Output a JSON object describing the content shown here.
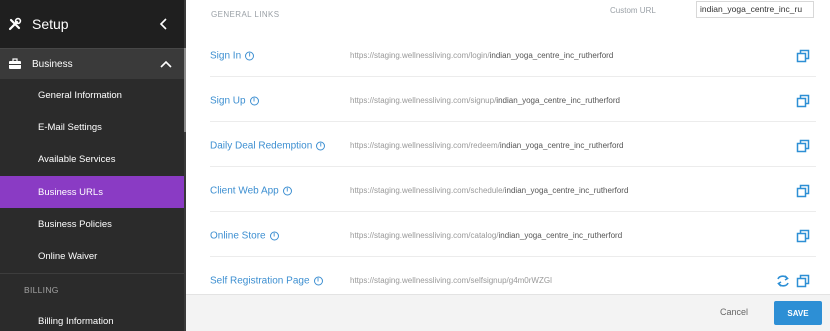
{
  "sidebar": {
    "title": "Setup",
    "section": "Business",
    "items": [
      {
        "label": "General Information",
        "active": false
      },
      {
        "label": "E-Mail Settings",
        "active": false
      },
      {
        "label": "Available Services",
        "active": false
      },
      {
        "label": "Business URLs",
        "active": true
      },
      {
        "label": "Business Policies",
        "active": false
      },
      {
        "label": "Online Waiver",
        "active": false
      }
    ],
    "divider": "BILLING",
    "billing_items": [
      {
        "label": "Billing Information"
      }
    ]
  },
  "main": {
    "section_title": "GENERAL LINKS",
    "custom_url_label": "Custom URL",
    "custom_url_value": "indian_yoga_centre_inc_ru",
    "links": [
      {
        "name": "Sign In",
        "base": "https://staging.wellnessliving.com/login/",
        "slug": "indian_yoga_centre_inc_rutherford",
        "refresh": false
      },
      {
        "name": "Sign Up",
        "base": "https://staging.wellnessliving.com/signup/",
        "slug": "indian_yoga_centre_inc_rutherford",
        "refresh": false
      },
      {
        "name": "Daily Deal Redemption",
        "base": "https://staging.wellnessliving.com/redeem/",
        "slug": "indian_yoga_centre_inc_rutherford",
        "refresh": false
      },
      {
        "name": "Client Web App",
        "base": "https://staging.wellnessliving.com/schedule/",
        "slug": "indian_yoga_centre_inc_rutherford",
        "refresh": false
      },
      {
        "name": "Online Store",
        "base": "https://staging.wellnessliving.com/catalog/",
        "slug": "indian_yoga_centre_inc_rutherford",
        "refresh": false
      },
      {
        "name": "Self Registration Page",
        "base": "https://staging.wellnessliving.com/selfsignup/g4m0rWZGl",
        "slug": "",
        "refresh": true
      }
    ]
  },
  "footer": {
    "cancel_label": "Cancel",
    "save_label": "SAVE"
  },
  "colors": {
    "accent": "#8a3bc4",
    "link": "#3d8fd1",
    "save": "#2d8fd5",
    "sidebar_bg": "#2b2b2b"
  },
  "icons": {
    "logo": "wrench-screwdriver-icon",
    "collapse": "chevron-left-icon",
    "section": "briefcase-icon",
    "section_toggle": "chevron-up-icon",
    "info": "info-icon",
    "copy": "copy-icon",
    "refresh": "refresh-icon"
  }
}
